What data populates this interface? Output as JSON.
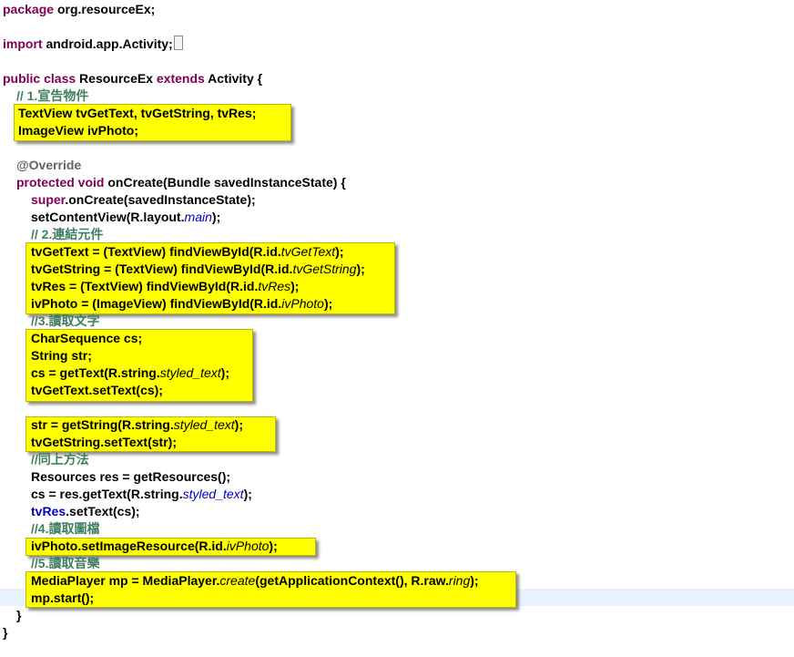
{
  "code_lines": [
    {
      "t": [
        [
          "kw",
          "package"
        ],
        [
          "",
          "org.resourceEx;"
        ]
      ]
    },
    {
      "t": []
    },
    {
      "t": [
        [
          "kw",
          "import"
        ],
        [
          "",
          "android.app.Activity;"
        ]
      ]
    },
    {
      "t": []
    },
    {
      "t": [
        [
          "kw",
          "public class"
        ],
        [
          "",
          " ResourceEx "
        ],
        [
          "kw",
          "extends"
        ],
        [
          "",
          " Activity {"
        ]
      ]
    },
    {
      "t": [
        [
          "cm",
          "// 1.宣告物件"
        ]
      ]
    },
    {
      "t": [
        [
          "",
          "TextView tvGetText, tvGetString, tvRes;"
        ]
      ]
    },
    {
      "t": [
        [
          "",
          "ImageView ivPhoto;"
        ]
      ]
    },
    {
      "t": []
    },
    {
      "t": [
        [
          "ann",
          "@Override"
        ]
      ]
    },
    {
      "t": [
        [
          "kw",
          "protected void"
        ],
        [
          "",
          " onCreate(Bundle savedInstanceState) {"
        ]
      ]
    },
    {
      "t": [
        [
          "kw",
          "super"
        ],
        [
          "",
          ".onCreate(savedInstanceState);"
        ]
      ]
    },
    {
      "t": [
        [
          "",
          "setContentView(R.layout."
        ],
        [
          "fld",
          "main"
        ],
        [
          "",
          ");"
        ]
      ]
    },
    {
      "t": [
        [
          "cm",
          "// 2.連結元件"
        ]
      ]
    },
    {
      "t": [
        [
          "",
          "tvGetText = (TextView) findViewById(R.id."
        ],
        [
          "it",
          "tvGetText"
        ],
        [
          "",
          ");"
        ]
      ]
    },
    {
      "t": [
        [
          "",
          "tvGetString = (TextView) findViewById(R.id."
        ],
        [
          "it",
          "tvGetString"
        ],
        [
          "",
          ");"
        ]
      ]
    },
    {
      "t": [
        [
          "",
          "tvRes = (TextView) findViewById(R.id."
        ],
        [
          "it",
          "tvRes"
        ],
        [
          "",
          ");"
        ]
      ]
    },
    {
      "t": [
        [
          "",
          "ivPhoto = (ImageView) findViewById(R.id."
        ],
        [
          "it",
          "ivPhoto"
        ],
        [
          "",
          ");"
        ]
      ]
    },
    {
      "t": [
        [
          "cm",
          "//3.讀取文字"
        ]
      ]
    },
    {
      "t": [
        [
          "",
          "CharSequence cs;"
        ]
      ]
    },
    {
      "t": [
        [
          "",
          "String str;"
        ]
      ]
    },
    {
      "t": [
        [
          "",
          "cs = getText(R.string."
        ],
        [
          "it",
          "styled_text"
        ],
        [
          "",
          ");"
        ]
      ]
    },
    {
      "t": [
        [
          "",
          "tvGetText.setText(cs);"
        ]
      ]
    },
    {
      "t": []
    },
    {
      "t": [
        [
          "",
          "str = getString(R.string."
        ],
        [
          "it",
          "styled_text"
        ],
        [
          "",
          ");"
        ]
      ]
    },
    {
      "t": [
        [
          "",
          "tvGetString.setText(str);"
        ]
      ]
    },
    {
      "t": [
        [
          "cm",
          "//同上方法"
        ]
      ]
    },
    {
      "t": [
        [
          "",
          "Resources res = getResources();"
        ]
      ]
    },
    {
      "t": [
        [
          "",
          "cs = res.getText(R.string."
        ],
        [
          "fld",
          "styled_text"
        ],
        [
          "",
          ");"
        ]
      ]
    },
    {
      "t": [
        [
          "fldb",
          "tvRes"
        ],
        [
          "",
          ".setText(cs);"
        ]
      ]
    },
    {
      "t": [
        [
          "cm",
          "//4.讀取圖檔"
        ]
      ]
    },
    {
      "t": [
        [
          "",
          "ivPhoto.setImageResource(R.id."
        ],
        [
          "it",
          "ivPhoto"
        ],
        [
          "",
          ");"
        ]
      ]
    },
    {
      "t": [
        [
          "cm",
          "//5.讀取音樂"
        ]
      ]
    },
    {
      "t": [
        [
          "",
          "MediaPlayer mp = MediaPlayer."
        ],
        [
          "it",
          "create"
        ],
        [
          "",
          "(getApplicationContext(), R.raw."
        ],
        [
          "it",
          "ring"
        ],
        [
          "",
          ");"
        ]
      ]
    },
    {
      "t": [
        [
          "",
          "mp.start();"
        ]
      ]
    },
    {
      "t": [
        [
          "",
          "}"
        ]
      ]
    },
    {
      "t": [
        [
          "",
          "}"
        ]
      ]
    }
  ]
}
